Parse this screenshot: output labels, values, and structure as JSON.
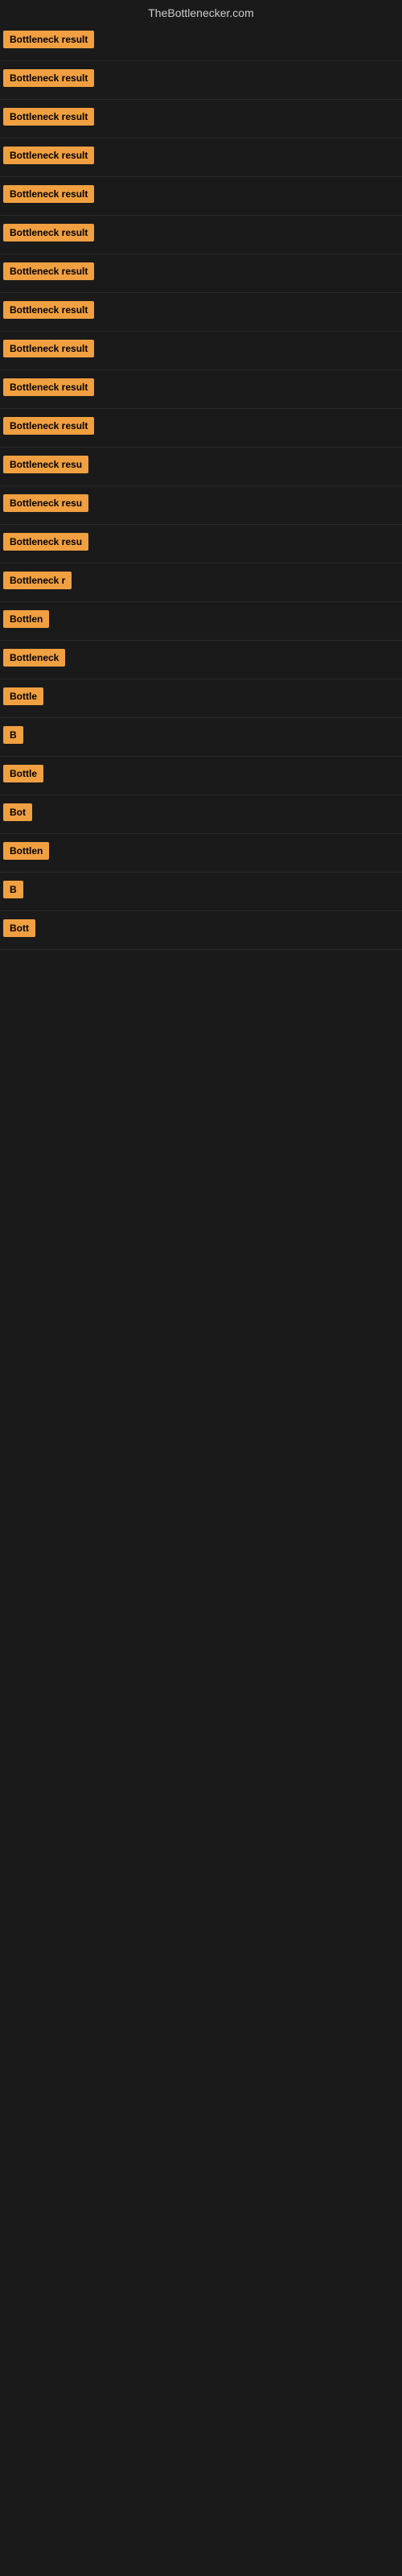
{
  "site": {
    "title": "TheBottlenecker.com"
  },
  "results": [
    {
      "id": 1,
      "label": "Bottleneck result",
      "visible_text": "Bottleneck result"
    },
    {
      "id": 2,
      "label": "Bottleneck result",
      "visible_text": "Bottleneck result"
    },
    {
      "id": 3,
      "label": "Bottleneck result",
      "visible_text": "Bottleneck result"
    },
    {
      "id": 4,
      "label": "Bottleneck result",
      "visible_text": "Bottleneck result"
    },
    {
      "id": 5,
      "label": "Bottleneck result",
      "visible_text": "Bottleneck result"
    },
    {
      "id": 6,
      "label": "Bottleneck result",
      "visible_text": "Bottleneck result"
    },
    {
      "id": 7,
      "label": "Bottleneck result",
      "visible_text": "Bottleneck result"
    },
    {
      "id": 8,
      "label": "Bottleneck result",
      "visible_text": "Bottleneck result"
    },
    {
      "id": 9,
      "label": "Bottleneck result",
      "visible_text": "Bottleneck result"
    },
    {
      "id": 10,
      "label": "Bottleneck result",
      "visible_text": "Bottleneck result"
    },
    {
      "id": 11,
      "label": "Bottleneck result",
      "visible_text": "Bottleneck result"
    },
    {
      "id": 12,
      "label": "Bottleneck resu",
      "visible_text": "Bottleneck resu"
    },
    {
      "id": 13,
      "label": "Bottleneck resu",
      "visible_text": "Bottleneck resu"
    },
    {
      "id": 14,
      "label": "Bottleneck resu",
      "visible_text": "Bottleneck resu"
    },
    {
      "id": 15,
      "label": "Bottleneck r",
      "visible_text": "Bottleneck r"
    },
    {
      "id": 16,
      "label": "Bottlen",
      "visible_text": "Bottlen"
    },
    {
      "id": 17,
      "label": "Bottleneck",
      "visible_text": "Bottleneck"
    },
    {
      "id": 18,
      "label": "Bottle",
      "visible_text": "Bottle"
    },
    {
      "id": 19,
      "label": "B",
      "visible_text": "B"
    },
    {
      "id": 20,
      "label": "Bottle",
      "visible_text": "Bottle"
    },
    {
      "id": 21,
      "label": "Bot",
      "visible_text": "Bot"
    },
    {
      "id": 22,
      "label": "Bottlen",
      "visible_text": "Bottlen"
    },
    {
      "id": 23,
      "label": "B",
      "visible_text": "B"
    },
    {
      "id": 24,
      "label": "Bott",
      "visible_text": "Bott"
    }
  ]
}
